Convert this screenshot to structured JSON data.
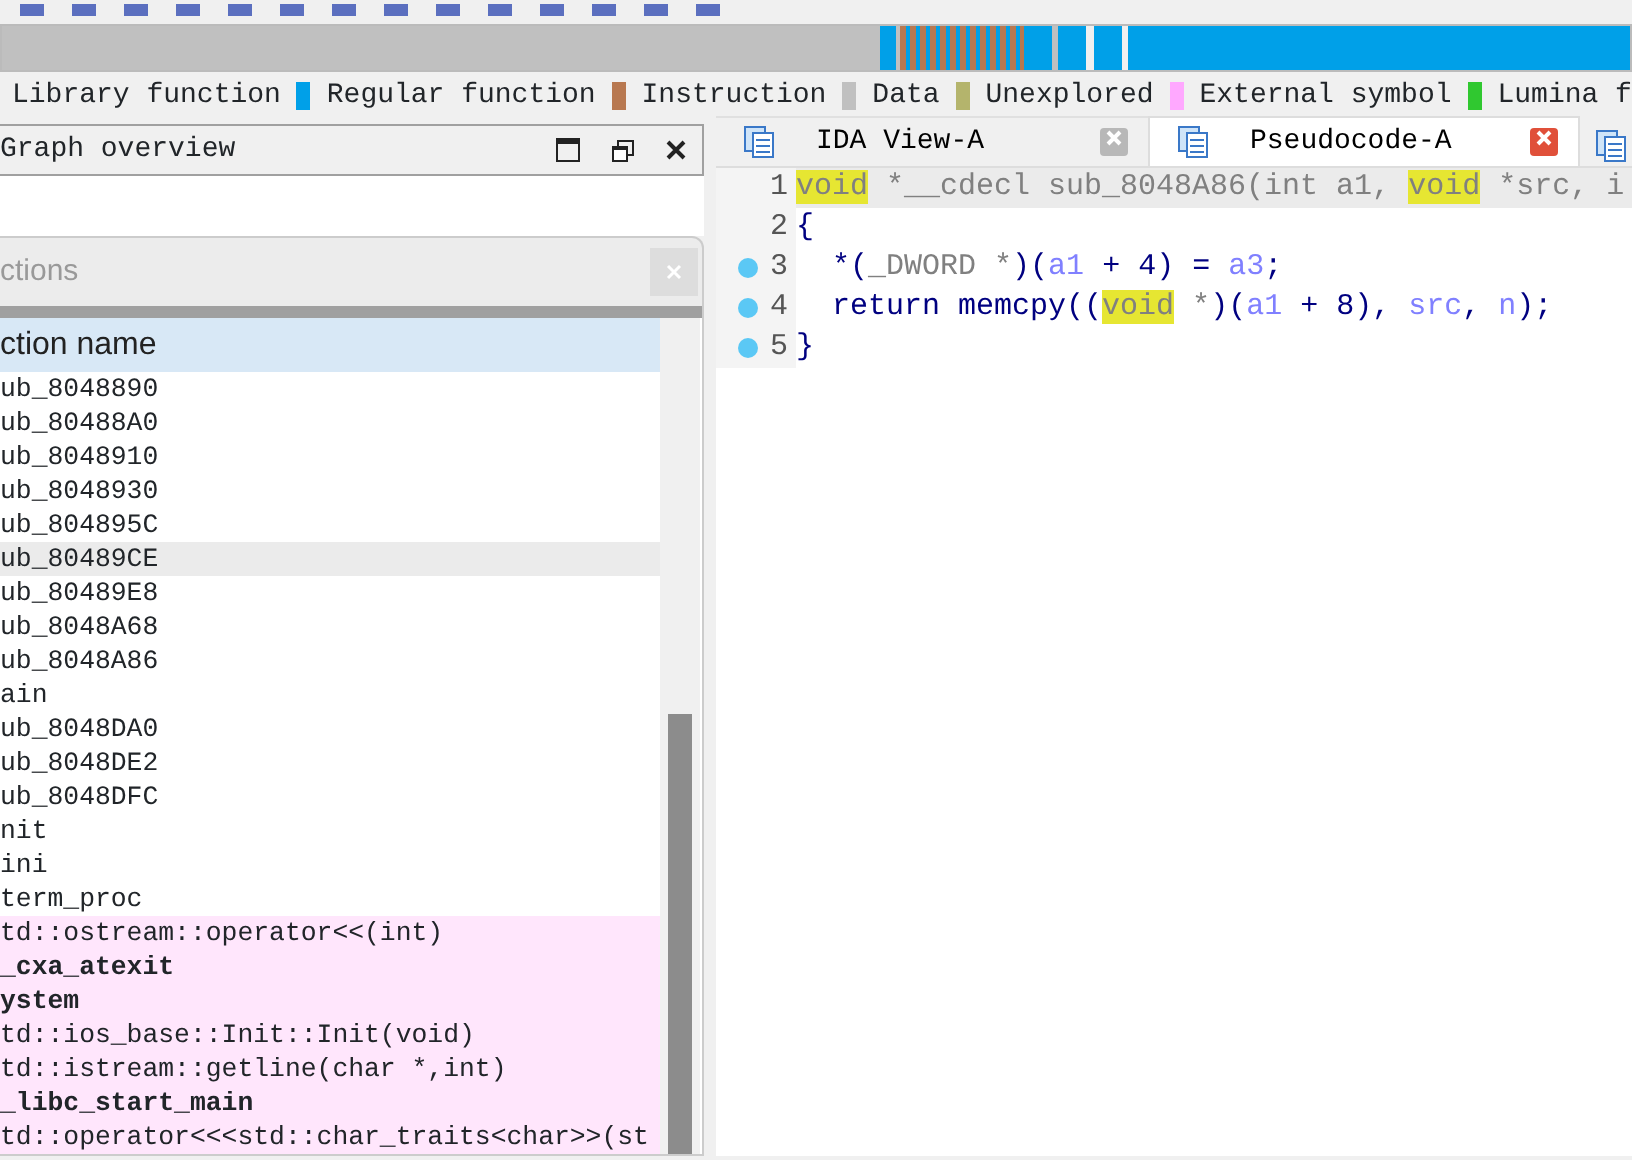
{
  "legend": [
    {
      "label": "Library function"
    },
    {
      "label": "Regular function",
      "color": "#00a0e8"
    },
    {
      "label": "Instruction",
      "color": "#b87850"
    },
    {
      "label": "Data",
      "color": "#c0c0c0"
    },
    {
      "label": "Unexplored",
      "color": "#b4b46c"
    },
    {
      "label": "External symbol",
      "color": "#ffa8ff"
    },
    {
      "label": "Lumina f",
      "color": "#30c830"
    }
  ],
  "graph_overview": {
    "title": "Graph overview"
  },
  "functions_window": {
    "title": "ctions",
    "column": "ction name",
    "rows": [
      {
        "name": "ub_8048890",
        "kind": "regular",
        "selected": false
      },
      {
        "name": "ub_80488A0",
        "kind": "regular",
        "selected": false
      },
      {
        "name": "ub_8048910",
        "kind": "regular",
        "selected": false
      },
      {
        "name": "ub_8048930",
        "kind": "regular",
        "selected": false
      },
      {
        "name": "ub_804895C",
        "kind": "regular",
        "selected": false
      },
      {
        "name": "ub_80489CE",
        "kind": "regular",
        "selected": true
      },
      {
        "name": "ub_80489E8",
        "kind": "regular",
        "selected": false
      },
      {
        "name": "ub_8048A68",
        "kind": "regular",
        "selected": false
      },
      {
        "name": "ub_8048A86",
        "kind": "regular",
        "selected": false
      },
      {
        "name": "ain",
        "kind": "regular",
        "selected": false
      },
      {
        "name": "ub_8048DA0",
        "kind": "regular",
        "selected": false
      },
      {
        "name": "ub_8048DE2",
        "kind": "regular",
        "selected": false
      },
      {
        "name": "ub_8048DFC",
        "kind": "regular",
        "selected": false
      },
      {
        "name": "nit",
        "kind": "regular",
        "selected": false
      },
      {
        "name": "ini",
        "kind": "regular",
        "selected": false
      },
      {
        "name": "term_proc",
        "kind": "regular",
        "selected": false
      },
      {
        "name": "td::ostream::operator<<(int)",
        "kind": "external",
        "selected": false
      },
      {
        "name": "_cxa_atexit",
        "kind": "import",
        "selected": false
      },
      {
        "name": "ystem",
        "kind": "import",
        "selected": false
      },
      {
        "name": "td::ios_base::Init::Init(void)",
        "kind": "external",
        "selected": false
      },
      {
        "name": "td::istream::getline(char *,int)",
        "kind": "external",
        "selected": false
      },
      {
        "name": "_libc_start_main",
        "kind": "import",
        "selected": false
      },
      {
        "name": "td::operator<<<std::char_traits<char>>(st",
        "kind": "external",
        "selected": false
      }
    ]
  },
  "tabs": [
    {
      "label": "IDA View-A",
      "selected": false
    },
    {
      "label": "Pseudocode-A",
      "selected": true
    }
  ],
  "code_lines": [
    {
      "number": "1",
      "breakpoint": false,
      "current": true,
      "tokens": [
        {
          "text": "void",
          "kind": "hl"
        },
        {
          "text": " *__cdecl sub_8048A86(int a1, ",
          "kind": "dim"
        },
        {
          "text": "void",
          "kind": "hl"
        },
        {
          "text": " *src, i",
          "kind": "dim"
        }
      ]
    },
    {
      "number": "2",
      "breakpoint": false,
      "current": false,
      "tokens": [
        {
          "text": "{",
          "kind": "text"
        }
      ]
    },
    {
      "number": "3",
      "breakpoint": true,
      "current": false,
      "tokens": [
        {
          "text": "  *(",
          "kind": "text"
        },
        {
          "text": "_DWORD *",
          "kind": "type"
        },
        {
          "text": ")(",
          "kind": "text"
        },
        {
          "text": "a1",
          "kind": "var"
        },
        {
          "text": " + 4) = ",
          "kind": "text"
        },
        {
          "text": "a3",
          "kind": "var"
        },
        {
          "text": ";",
          "kind": "text"
        }
      ]
    },
    {
      "number": "4",
      "breakpoint": true,
      "current": false,
      "tokens": [
        {
          "text": "  return memcpy((",
          "kind": "text"
        },
        {
          "text": "void",
          "kind": "hl"
        },
        {
          "text": " *",
          "kind": "type"
        },
        {
          "text": ")(",
          "kind": "text"
        },
        {
          "text": "a1",
          "kind": "var"
        },
        {
          "text": " + 8), ",
          "kind": "text"
        },
        {
          "text": "src",
          "kind": "var"
        },
        {
          "text": ", ",
          "kind": "text"
        },
        {
          "text": "n",
          "kind": "var"
        },
        {
          "text": ");",
          "kind": "text"
        }
      ]
    },
    {
      "number": "5",
      "breakpoint": true,
      "current": false,
      "tokens": [
        {
          "text": "}",
          "kind": "text"
        }
      ]
    }
  ]
}
